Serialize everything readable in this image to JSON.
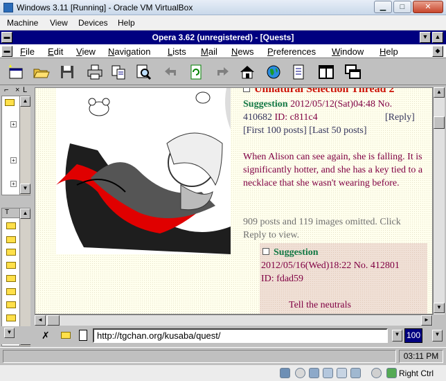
{
  "vbox": {
    "title": "Windows 3.11 [Running] - Oracle VM VirtualBox",
    "menu": [
      "Machine",
      "View",
      "Devices",
      "Help"
    ],
    "host_key": "Right Ctrl"
  },
  "opera": {
    "title": "Opera 3.62 (unregistered) - [Quests]",
    "menu": [
      "File",
      "Edit",
      "View",
      "Navigation",
      "Lists",
      "Mail",
      "News",
      "Preferences",
      "Window",
      "Help"
    ],
    "toolbar_icons": [
      "new-page-icon",
      "open-folder-icon",
      "save-icon",
      "print-icon",
      "copy-icon",
      "find-icon",
      "back-icon",
      "reload-icon",
      "forward-icon",
      "home-icon",
      "globe-icon",
      "bookmarks-icon",
      "single-window-icon",
      "cascade-windows-icon"
    ]
  },
  "page": {
    "thread_title": "Unnatural Selection Thread 2",
    "op": {
      "subject": "Suggestion",
      "date": "2012/05/12(Sat)04:48 No.",
      "number": "410682",
      "id": "ID: c811c4",
      "reply": "[Reply]",
      "first": "[First 100 posts]",
      "last": "[Last 50 posts]",
      "body": "When Alison can see again, she is falling. It is significantly hotter, and she has a key tied to a necklace that she wasn't wearing before.",
      "omitted": "909 posts and 119 images omitted. Click Reply to view."
    },
    "reply1": {
      "subject": "Suggestion",
      "date": "2012/05/16(Wed)18:22 No. 412801",
      "id": "ID: fdad59",
      "body_line1": "Tell the neutrals"
    }
  },
  "address": {
    "url": "http://tgchan.org/kusaba/quest/",
    "zoom": "100"
  },
  "status": {
    "clock": "03:11 PM"
  }
}
